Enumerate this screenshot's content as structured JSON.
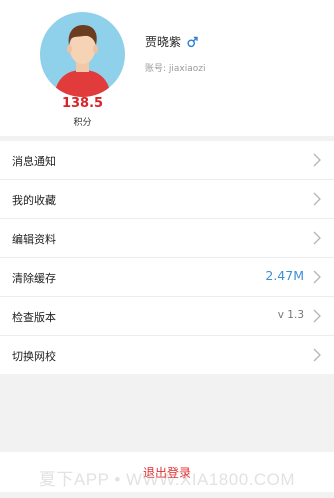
{
  "profile": {
    "points_value": "138.5",
    "points_label": "积分",
    "name": "贾晓紫",
    "account": "账号: jiaxiaozi"
  },
  "menu": {
    "items": [
      {
        "label": "消息通知",
        "value": ""
      },
      {
        "label": "我的收藏",
        "value": ""
      },
      {
        "label": "编辑资料",
        "value": ""
      },
      {
        "label": "清除缓存",
        "value": "2.47M"
      },
      {
        "label": "检查版本",
        "value": "v 1.3"
      },
      {
        "label": "切换网校",
        "value": ""
      }
    ]
  },
  "footer": {
    "logout_label": "退出登录",
    "watermark": "夏下APP • WWW.XIA1800.COM"
  },
  "colors": {
    "points": "#d8232a",
    "cache_value": "#3d8fd8",
    "logout": "#e03030",
    "gender": "#2a7fd4"
  }
}
